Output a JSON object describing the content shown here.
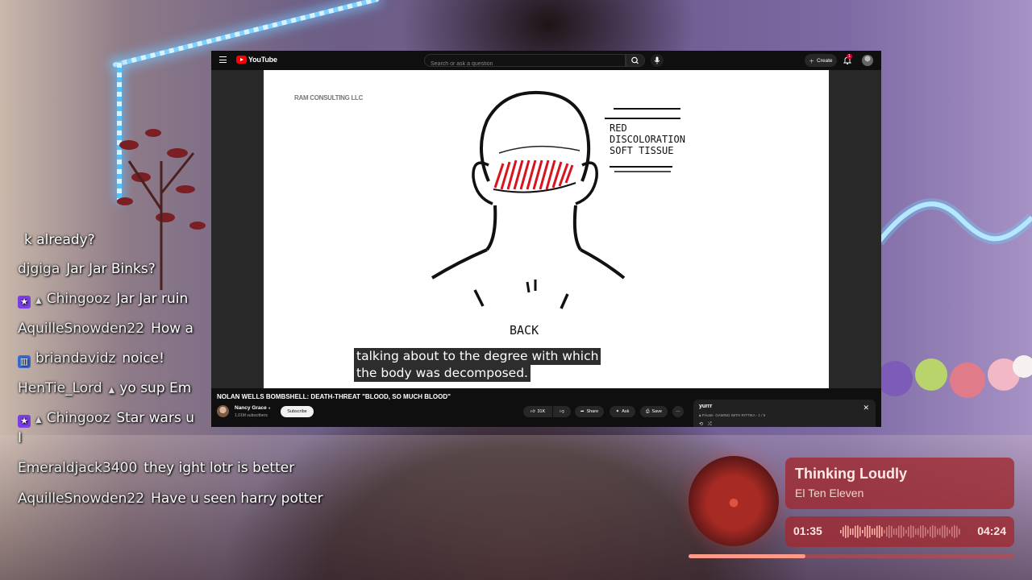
{
  "chat": {
    "messages": [
      {
        "user": "",
        "text": "k already?",
        "badge": ""
      },
      {
        "user": "djgiga",
        "text": "Jar Jar Binks?",
        "badge": ""
      },
      {
        "user": "Chingooz",
        "text": "Jar Jar ruin",
        "badge": "star"
      },
      {
        "user": "AquilleSnowden22",
        "text": "How a",
        "badge": ""
      },
      {
        "user": "briandavidz",
        "text": "noice!",
        "badge": "bars"
      },
      {
        "user": "HenTie_Lord",
        "text": "yo sup Em",
        "badge": ""
      },
      {
        "user": "Chingooz",
        "text": "Star wars u",
        "badge": "star"
      },
      {
        "user": "",
        "text": "I",
        "badge": ""
      },
      {
        "user": "Emeraldjack3400",
        "text": "they ight lotr is better",
        "badge": ""
      },
      {
        "user": "AquilleSnowden22",
        "text": "Have u seen harry potter",
        "badge": ""
      }
    ]
  },
  "youtube": {
    "logo_text": "YouTube",
    "search_placeholder": "Search or ask a question",
    "create_label": "Create",
    "notification_count": "1",
    "video": {
      "watermark": "RAM CONSULTING LLC",
      "drawing_label": "BACK",
      "annotation_lines": [
        "RED",
        "DISCOLORATION",
        "SOFT TISSUE"
      ],
      "caption_line1": "talking about to the degree with which",
      "caption_line2": "the body was decomposed."
    },
    "title": "NOLAN WELLS BOMBSHELL: DEATH-THREAT \"BLOOD, SO MUCH BLOOD\"",
    "channel": {
      "name": "Nancy Grace",
      "subscribers": "1.01M subscribers"
    },
    "subscribe_label": "Subscribe",
    "actions": {
      "likes": "31K",
      "share": "Share",
      "ask": "Ask",
      "save": "Save"
    },
    "playlist": {
      "title": "yurrr",
      "privacy": "Private",
      "subtitle": "GAMING WITH RITTIKA - 1 / 5"
    }
  },
  "now_playing": {
    "title": "Thinking Loudly",
    "artist": "El Ten Eleven",
    "elapsed": "01:35",
    "total": "04:24",
    "progress": 0.36
  },
  "colors": {
    "accent_red": "#ff0000",
    "card": "#a0282e"
  }
}
